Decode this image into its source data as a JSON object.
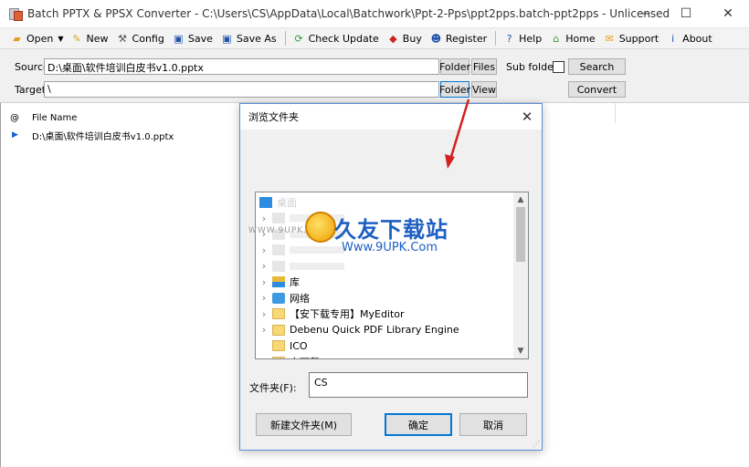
{
  "window": {
    "title": "Batch PPTX & PPSX Converter - C:\\Users\\CS\\AppData\\Local\\Batchwork\\Ppt-2-Pps\\ppt2pps.batch-ppt2pps - Unlicensed",
    "minimize": "—",
    "maximize": "☐",
    "close": "✕"
  },
  "toolbar": {
    "items": [
      {
        "label": "Open",
        "icon": "open-folder-icon",
        "color": "#e0a020",
        "glyph": "▰"
      },
      {
        "label": "New",
        "icon": "new-document-icon",
        "color": "#e0a020",
        "glyph": "✎"
      },
      {
        "label": "Config",
        "icon": "config-tools-icon",
        "color": "#555555",
        "glyph": "⚒"
      },
      {
        "label": "Save",
        "icon": "save-disk-icon",
        "color": "#2255aa",
        "glyph": "▣"
      },
      {
        "label": "Save As",
        "icon": "save-as-icon",
        "color": "#2255aa",
        "glyph": "▣"
      },
      {
        "label": "Check Update",
        "icon": "check-update-icon",
        "color": "#2a9d3a",
        "glyph": "⟳"
      },
      {
        "label": "Buy",
        "icon": "buy-icon",
        "color": "#cc2222",
        "glyph": "◆"
      },
      {
        "label": "Register",
        "icon": "register-icon",
        "color": "#2255aa",
        "glyph": "☻"
      },
      {
        "label": "Help",
        "icon": "help-icon",
        "color": "#2255aa",
        "glyph": "?"
      },
      {
        "label": "Home",
        "icon": "home-icon",
        "color": "#2a9d3a",
        "glyph": "⌂"
      },
      {
        "label": "Support",
        "icon": "support-icon",
        "color": "#e0a020",
        "glyph": "✉"
      },
      {
        "label": "About",
        "icon": "about-icon",
        "color": "#2255aa",
        "glyph": "i"
      }
    ]
  },
  "paths": {
    "source_label": "Source",
    "source_value": "D:\\桌面\\软件培训白皮书v1.0.pptx",
    "target_label": "Target",
    "target_value": "\\",
    "folder_button": "Folder",
    "files_button": "Files",
    "subfolders_label": "Sub folders",
    "search_button": "Search",
    "view_button": "View",
    "convert_button": "Convert"
  },
  "filelist": {
    "col_icon": "@",
    "col_name": "File Name",
    "rows": [
      {
        "name": "D:\\桌面\\软件培训白皮书v1.0.pptx"
      }
    ]
  },
  "dialog": {
    "title": "浏览文件夹",
    "close": "✕",
    "tree": [
      {
        "label": "桌面",
        "type": "desktop",
        "expandable": false
      },
      {
        "label": "",
        "type": "blurred",
        "expandable": true
      },
      {
        "label": "",
        "type": "blurred",
        "expandable": true
      },
      {
        "label": "",
        "type": "blurred",
        "expandable": true
      },
      {
        "label": "",
        "type": "blurred",
        "expandable": true
      },
      {
        "label": "库",
        "type": "library",
        "expandable": true
      },
      {
        "label": "网络",
        "type": "network",
        "expandable": true
      },
      {
        "label": "【安下载专用】MyEditor",
        "type": "folder",
        "expandable": true
      },
      {
        "label": "Debenu Quick PDF Library Engine",
        "type": "folder",
        "expandable": true
      },
      {
        "label": "ICO",
        "type": "folder",
        "expandable": false
      },
      {
        "label": "安下载",
        "type": "folder",
        "expandable": true
      }
    ],
    "folder_label": "文件夹(F):",
    "folder_value": "CS",
    "new_folder_button": "新建文件夹(M)",
    "ok_button": "确定",
    "cancel_button": "取消"
  },
  "watermark": {
    "main": "久友下载站",
    "url": "Www.9UPK.Com",
    "left": "WWW.9UPK.COM"
  }
}
